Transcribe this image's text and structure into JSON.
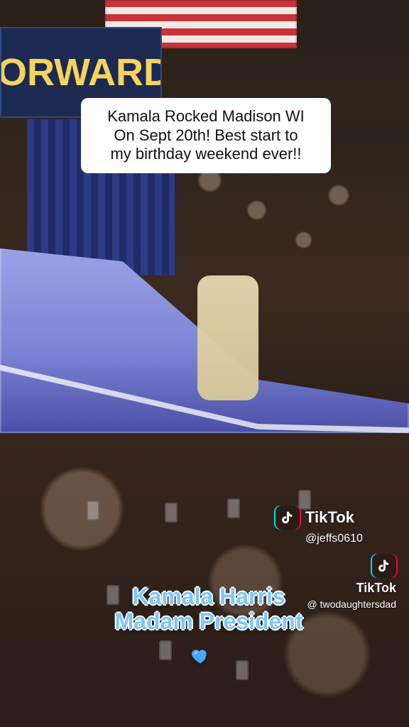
{
  "background": {
    "banner_text": "ORWARD"
  },
  "caption": {
    "text": "Kamala Rocked Madison WI\nOn Sept 20th! Best start to\nmy birthday weekend ever!!"
  },
  "watermarks": [
    {
      "brand": "TikTok",
      "handle": "@jeffs0610",
      "icon": "tiktok-icon"
    },
    {
      "brand": "TikTok",
      "handle": "@ twodaughtersdad",
      "icon": "tiktok-icon"
    }
  ],
  "overlay_text": {
    "line1": "Kamala Harris",
    "line2": "Madam President"
  },
  "icons": {
    "heart": "blue-heart-icon"
  },
  "colors": {
    "overlay_text": "#7cc6ff",
    "heart": "#4aa6ff",
    "tiktok_red": "#ff0050",
    "tiktok_cyan": "#00f0ff"
  }
}
